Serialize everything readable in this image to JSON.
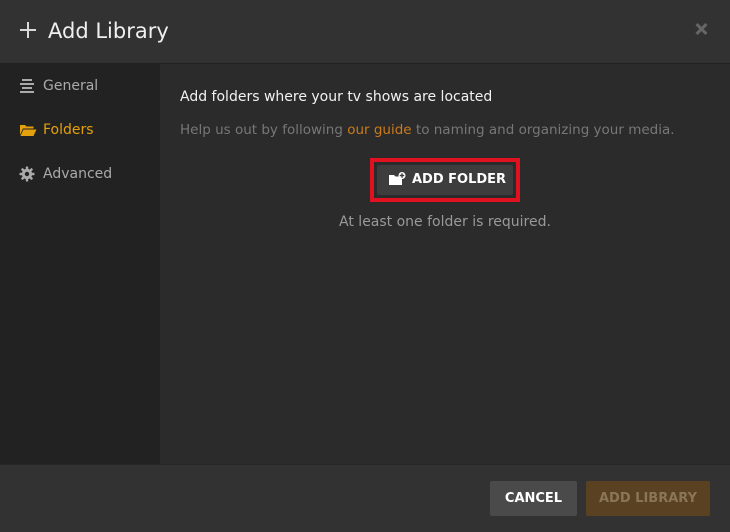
{
  "dialog": {
    "title": "Add Library"
  },
  "sidebar": {
    "items": [
      {
        "label": "General",
        "icon": "general-lines-icon",
        "active": false
      },
      {
        "label": "Folders",
        "icon": "folder-icon",
        "active": true
      },
      {
        "label": "Advanced",
        "icon": "gear-icon",
        "active": false
      }
    ]
  },
  "main": {
    "heading": "Add folders where your tv shows are located",
    "help_prefix": "Help us out by following ",
    "help_link": "our guide",
    "help_suffix": " to naming and organizing your media.",
    "add_folder_label": "ADD FOLDER",
    "add_folder_icon": "folder-plus-icon",
    "required_note": "At least one folder is required."
  },
  "footer": {
    "cancel_label": "CANCEL",
    "add_library_label": "ADD LIBRARY"
  },
  "colors": {
    "accent": "#e5a00d",
    "link": "#cc7b19",
    "highlight_border": "#e0121f",
    "add_library_bg": "#5a4122"
  }
}
